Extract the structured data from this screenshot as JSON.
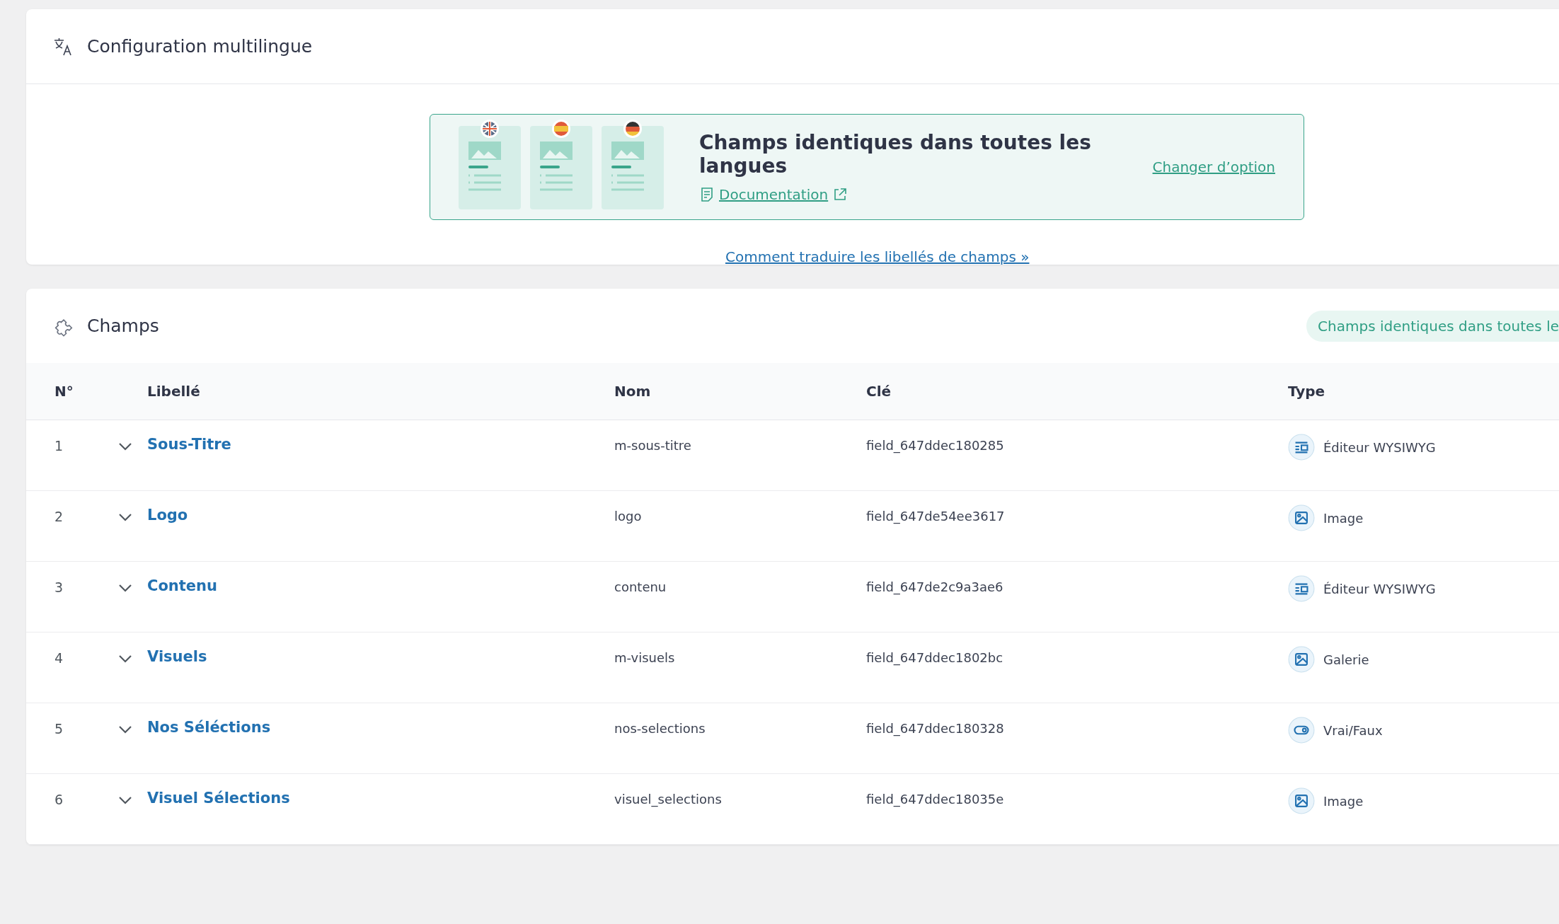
{
  "config_card": {
    "title": "Configuration multilingue",
    "banner": {
      "heading": "Champs identiques dans toutes les langues",
      "doc_link": "Documentation",
      "change_link": "Changer d’option"
    },
    "help_link": "Comment traduire les libellés de champs »"
  },
  "fields_card": {
    "title": "Champs",
    "badge": "Champs identiques dans toutes le",
    "columns": [
      "N°",
      "Libellé",
      "Nom",
      "Clé",
      "Type"
    ],
    "rows": [
      {
        "number": "1",
        "label": "Sous-Titre",
        "name": "m-sous-titre",
        "key": "field_647ddec180285",
        "type": "Éditeur WYSIWYG",
        "kind": "editor"
      },
      {
        "number": "2",
        "label": "Logo",
        "name": "logo",
        "key": "field_647de54ee3617",
        "type": "Image",
        "kind": "image"
      },
      {
        "number": "3",
        "label": "Contenu",
        "name": "contenu",
        "key": "field_647de2c9a3ae6",
        "type": "Éditeur WYSIWYG",
        "kind": "editor"
      },
      {
        "number": "4",
        "label": "Visuels",
        "name": "m-visuels",
        "key": "field_647ddec1802bc",
        "type": "Galerie",
        "kind": "image"
      },
      {
        "number": "5",
        "label": "Nos Séléctions",
        "name": "nos-selections",
        "key": "field_647ddec180328",
        "type": "Vrai/Faux",
        "kind": "toggle"
      },
      {
        "number": "6",
        "label": "Visuel Sélections",
        "name": "visuel_selections",
        "key": "field_647ddec18035e",
        "type": "Image",
        "kind": "image"
      }
    ]
  }
}
